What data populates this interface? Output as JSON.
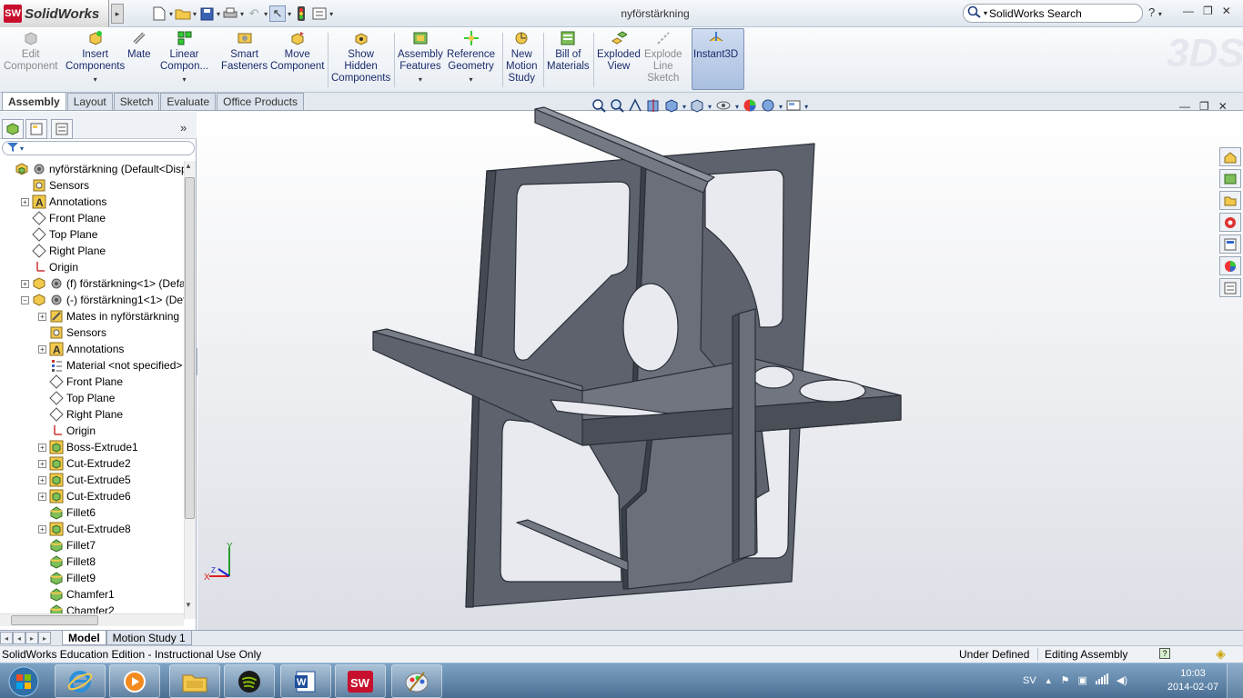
{
  "app": {
    "name": "SolidWorks",
    "document_title": "nyförstärkning"
  },
  "search": {
    "placeholder": "SolidWorks Search"
  },
  "help_label": "?",
  "commands": [
    {
      "label": "Edit Component",
      "lines": [
        "Edit",
        "Component"
      ],
      "enabled": false
    },
    {
      "label": "Insert Components",
      "lines": [
        "Insert",
        "Components"
      ],
      "enabled": true
    },
    {
      "label": "Mate",
      "lines": [
        "Mate"
      ],
      "enabled": true
    },
    {
      "label": "Linear Compon...",
      "lines": [
        "Linear",
        "Compon..."
      ],
      "enabled": true
    },
    {
      "label": "Smart Fasteners",
      "lines": [
        "Smart",
        "Fasteners"
      ],
      "enabled": true
    },
    {
      "label": "Move Component",
      "lines": [
        "Move",
        "Component"
      ],
      "enabled": true
    },
    {
      "label": "Show Hidden Components",
      "lines": [
        "Show",
        "Hidden",
        "Components"
      ],
      "enabled": true
    },
    {
      "label": "Assembly Features",
      "lines": [
        "Assembly",
        "Features"
      ],
      "enabled": true
    },
    {
      "label": "Reference Geometry",
      "lines": [
        "Reference",
        "Geometry"
      ],
      "enabled": true
    },
    {
      "label": "New Motion Study",
      "lines": [
        "New",
        "Motion",
        "Study"
      ],
      "enabled": true
    },
    {
      "label": "Bill of Materials",
      "lines": [
        "Bill of",
        "Materials"
      ],
      "enabled": true
    },
    {
      "label": "Exploded View",
      "lines": [
        "Exploded",
        "View"
      ],
      "enabled": true
    },
    {
      "label": "Explode Line Sketch",
      "lines": [
        "Explode",
        "Line",
        "Sketch"
      ],
      "enabled": false
    },
    {
      "label": "Instant3D",
      "lines": [
        "Instant3D"
      ],
      "enabled": true,
      "active": true
    }
  ],
  "tabs": [
    "Assembly",
    "Layout",
    "Sketch",
    "Evaluate",
    "Office Products"
  ],
  "active_tab": "Assembly",
  "tree": {
    "root": "nyförstärkning  (Default<Displ",
    "items": [
      {
        "label": "Sensors",
        "icon": "sensor-icon",
        "indent": 1,
        "expandable": false
      },
      {
        "label": "Annotations",
        "icon": "annotation-icon",
        "indent": 1,
        "expandable": true
      },
      {
        "label": "Front Plane",
        "icon": "plane-icon",
        "indent": 1,
        "expandable": false
      },
      {
        "label": "Top Plane",
        "icon": "plane-icon",
        "indent": 1,
        "expandable": false
      },
      {
        "label": "Right Plane",
        "icon": "plane-icon",
        "indent": 1,
        "expandable": false
      },
      {
        "label": "Origin",
        "icon": "origin-icon",
        "indent": 1,
        "expandable": false
      },
      {
        "label": "(f) förstärkning<1> (Defaul",
        "icon": "part-icon",
        "indent": 1,
        "expandable": true,
        "expanded": false
      },
      {
        "label": "(-) förstärkning1<1> (Defa",
        "icon": "part-icon",
        "indent": 1,
        "expandable": true,
        "expanded": true
      },
      {
        "label": "Mates in nyförstärkning",
        "icon": "mates-icon",
        "indent": 2,
        "expandable": true
      },
      {
        "label": "Sensors",
        "icon": "sensor-icon",
        "indent": 2,
        "expandable": false
      },
      {
        "label": "Annotations",
        "icon": "annotation-icon",
        "indent": 2,
        "expandable": true
      },
      {
        "label": "Material <not specified>",
        "icon": "material-icon",
        "indent": 2,
        "expandable": false
      },
      {
        "label": "Front Plane",
        "icon": "plane-icon",
        "indent": 2,
        "expandable": false
      },
      {
        "label": "Top Plane",
        "icon": "plane-icon",
        "indent": 2,
        "expandable": false
      },
      {
        "label": "Right Plane",
        "icon": "plane-icon",
        "indent": 2,
        "expandable": false
      },
      {
        "label": "Origin",
        "icon": "origin-icon",
        "indent": 2,
        "expandable": false
      },
      {
        "label": "Boss-Extrude1",
        "icon": "extrude-icon",
        "indent": 2,
        "expandable": true
      },
      {
        "label": "Cut-Extrude2",
        "icon": "extrude-icon",
        "indent": 2,
        "expandable": true
      },
      {
        "label": "Cut-Extrude5",
        "icon": "extrude-icon",
        "indent": 2,
        "expandable": true
      },
      {
        "label": "Cut-Extrude6",
        "icon": "extrude-icon",
        "indent": 2,
        "expandable": true
      },
      {
        "label": "Fillet6",
        "icon": "fillet-icon",
        "indent": 2,
        "expandable": false
      },
      {
        "label": "Cut-Extrude8",
        "icon": "extrude-icon",
        "indent": 2,
        "expandable": true
      },
      {
        "label": "Fillet7",
        "icon": "fillet-icon",
        "indent": 2,
        "expandable": false
      },
      {
        "label": "Fillet8",
        "icon": "fillet-icon",
        "indent": 2,
        "expandable": false
      },
      {
        "label": "Fillet9",
        "icon": "fillet-icon",
        "indent": 2,
        "expandable": false
      },
      {
        "label": "Chamfer1",
        "icon": "fillet-icon",
        "indent": 2,
        "expandable": false
      },
      {
        "label": "Chamfer2",
        "icon": "fillet-icon",
        "indent": 2,
        "expandable": false
      }
    ]
  },
  "bottom_tabs": [
    "Model",
    "Motion Study 1"
  ],
  "status": {
    "edition": "SolidWorks Education Edition - Instructional Use Only",
    "state": "Under Defined",
    "mode": "Editing Assembly"
  },
  "triad": {
    "x": "X",
    "y": "Y",
    "z": "Z"
  },
  "taskbar": {
    "apps": [
      "internet-explorer",
      "media-player",
      "file-explorer",
      "spotify",
      "word",
      "solidworks",
      "paint"
    ],
    "language": "SV",
    "time": "10:03",
    "date": "2014-02-07"
  }
}
